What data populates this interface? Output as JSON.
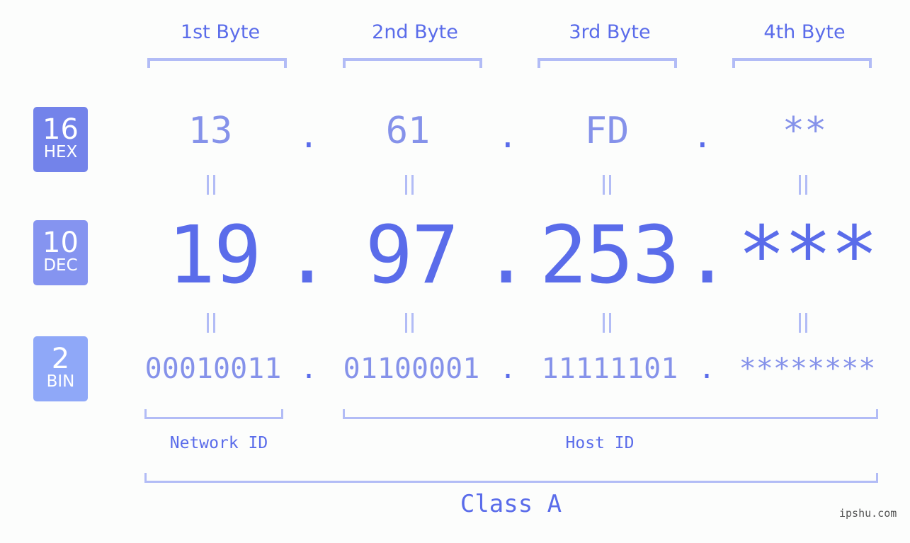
{
  "bytes": {
    "labels": [
      "1st Byte",
      "2nd Byte",
      "3rd Byte",
      "4th Byte"
    ]
  },
  "badges": {
    "hex": {
      "number": "16",
      "label": "HEX",
      "color": "#7383ea"
    },
    "dec": {
      "number": "10",
      "label": "DEC",
      "color": "#8594f0"
    },
    "bin": {
      "number": "2",
      "label": "BIN",
      "color": "#8fa8f8"
    }
  },
  "hex": [
    "13",
    "61",
    "FD",
    "**"
  ],
  "dec": [
    "19",
    "97",
    "253",
    "***"
  ],
  "bin": [
    "00010011",
    "01100001",
    "11111101",
    "********"
  ],
  "separator": ".",
  "ids": {
    "network": "Network ID",
    "host": "Host ID"
  },
  "class_label": "Class A",
  "watermark": "ipshu.com",
  "colors": {
    "accent": "#5a6cea",
    "light_text": "#8592ea",
    "bracket": "#b2bcf6",
    "background": "#fcfdfc"
  }
}
